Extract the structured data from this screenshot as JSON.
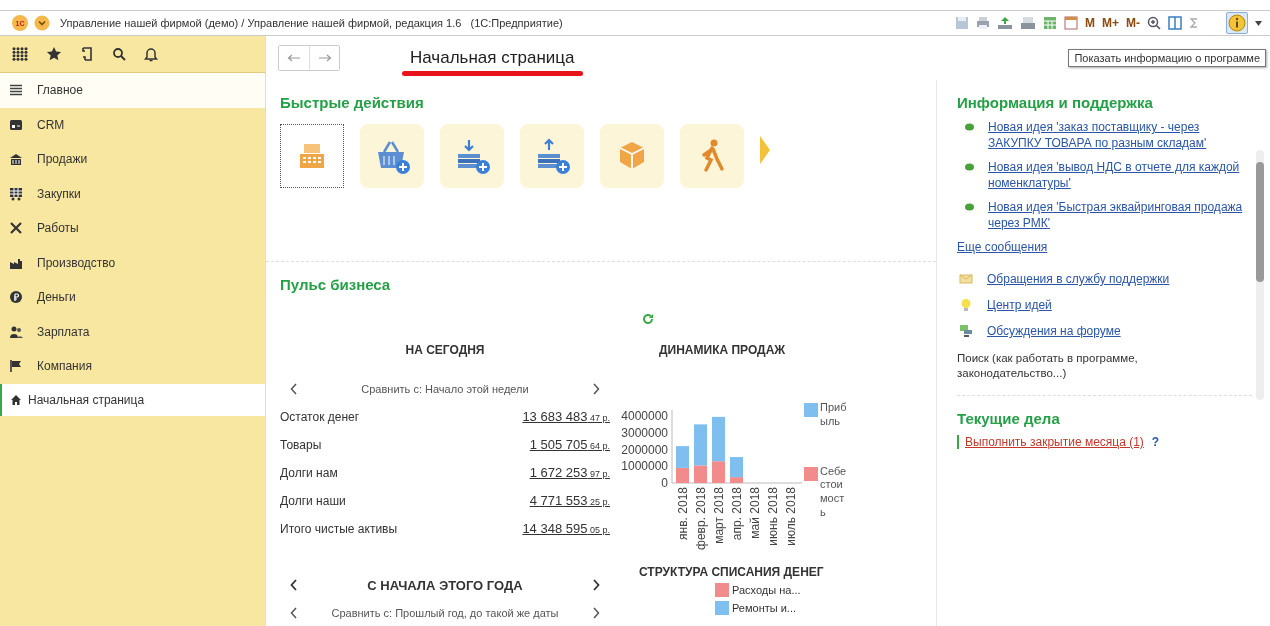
{
  "window": {
    "logo": "1С",
    "title": "Управление нашей фирмой (демо) / Управление нашей фирмой, редакция 1.6   (1С:Предприятие)"
  },
  "toolbar": {
    "memory_buttons": [
      "M",
      "M+",
      "M-"
    ],
    "tooltip": "Показать информацию о программе"
  },
  "sidebar": {
    "sections": [
      {
        "label": "Главное",
        "kind": "menu",
        "selected": true
      },
      {
        "label": "CRM",
        "kind": "card",
        "selected": false
      },
      {
        "label": "Продажи",
        "kind": "shop",
        "selected": false
      },
      {
        "label": "Закупки",
        "kind": "cart",
        "selected": false
      },
      {
        "label": "Работы",
        "kind": "tools",
        "selected": false
      },
      {
        "label": "Производство",
        "kind": "factory",
        "selected": false
      },
      {
        "label": "Деньги",
        "kind": "coin",
        "selected": false
      },
      {
        "label": "Зарплата",
        "kind": "people",
        "selected": false
      },
      {
        "label": "Компания",
        "kind": "flag",
        "selected": false
      }
    ],
    "open_windows": [
      {
        "label": "Начальная страница",
        "selected": true
      }
    ]
  },
  "page": {
    "title": "Начальная страница",
    "underlined": true
  },
  "quick_actions": {
    "title": "Быстрые действия",
    "items": [
      {
        "kind": "register",
        "selected": true
      },
      {
        "kind": "basket",
        "selected": false
      },
      {
        "kind": "money-in",
        "selected": false
      },
      {
        "kind": "money-out",
        "selected": false
      },
      {
        "kind": "box",
        "selected": false
      },
      {
        "kind": "walker",
        "selected": false
      }
    ]
  },
  "pulse": {
    "title": "Пульс бизнеса",
    "today": {
      "title": "НА СЕГОДНЯ",
      "compare": "Сравнить с: Начало этой недели",
      "rows": [
        {
          "label": "Остаток денег",
          "amount": "13 683 483",
          "cents": "47 р."
        },
        {
          "label": "Товары",
          "amount": "1 505 705",
          "cents": "64 р."
        },
        {
          "label": "Долги нам",
          "amount": "1 672 253",
          "cents": "97 р."
        },
        {
          "label": "Долги наши",
          "amount": "4 771 553",
          "cents": "25 р."
        },
        {
          "label": "Итого чистые активы",
          "amount": "14 348 595",
          "cents": "05 р."
        }
      ]
    },
    "year": {
      "title": "С НАЧАЛА ЭТОГО ГОДА",
      "compare": "Сравнить с: Прошлый год, до такой же даты"
    },
    "sales_chart": {
      "chart_data": {
        "type": "bar",
        "title": "ДИНАМИКА ПРОДАЖ",
        "stacked": true,
        "categories": [
          "янв. 2018",
          "февр. 2018",
          "март 2018",
          "апр. 2018",
          "май 2018",
          "июнь 2018",
          "июль 2018"
        ],
        "yticks": [
          0,
          1000000,
          2000000,
          3000000,
          4000000
        ],
        "ylim": [
          0,
          4000000
        ],
        "legend": true,
        "series": [
          {
            "name": "Себестоимость",
            "color": "#f28b8b",
            "values": [
              900000,
              1050000,
              1300000,
              350000,
              0,
              0,
              0
            ]
          },
          {
            "name": "Прибыль",
            "color": "#7fbff0",
            "values": [
              1300000,
              2450000,
              2650000,
              1200000,
              0,
              0,
              0
            ]
          }
        ]
      }
    },
    "writeoff_chart": {
      "title": "СТРУКТУРА СПИСАНИЯ ДЕНЕГ",
      "legend": [
        {
          "label": "Расходы на...",
          "color": "#f28b8b"
        },
        {
          "label": "Ремонты и...",
          "color": "#7fbff0"
        }
      ]
    }
  },
  "info": {
    "title": "Информация и поддержка",
    "news": [
      "Новая идея 'заказ поставщику - через ЗАКУПКУ ТОВАРА по разным складам'",
      "Новая идея 'вывод НДС в отчете для каждой номенклатуры'",
      "Новая идея 'Быстрая эквайринговая продажа через РМК'"
    ],
    "more": "Еще сообщения",
    "links": [
      {
        "kind": "mail",
        "label": "Обращения в службу поддержки"
      },
      {
        "kind": "idea",
        "label": "Центр идей"
      },
      {
        "kind": "forum",
        "label": "Обсуждения на форуме"
      }
    ],
    "search": "Поиск (как работать в программе, законодательство...)"
  },
  "tasks": {
    "title": "Текущие дела",
    "items": [
      {
        "label": "Выполнить закрытие месяца (1)",
        "help": "?"
      }
    ]
  }
}
